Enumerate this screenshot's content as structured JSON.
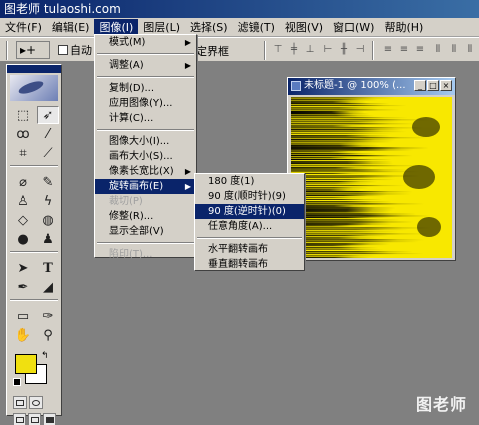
{
  "watermark_top": "图老师 tulaoshi.com",
  "watermark_bottom": "图老师",
  "menubar": {
    "items": [
      {
        "label": "文件(F)"
      },
      {
        "label": "编辑(E)"
      },
      {
        "label": "图像(I)"
      },
      {
        "label": "图层(L)"
      },
      {
        "label": "选择(S)"
      },
      {
        "label": "滤镜(T)"
      },
      {
        "label": "视图(V)"
      },
      {
        "label": "窗口(W)"
      },
      {
        "label": "帮助(H)"
      }
    ],
    "active_index": 2
  },
  "options": {
    "tool_preset": "▸+",
    "auto_select_label": "自动",
    "bounding_box_label": "定界框"
  },
  "image_menu": {
    "items": [
      {
        "label": "模式(M)",
        "submenu": true
      },
      {
        "sep": true
      },
      {
        "label": "调整(A)",
        "submenu": true
      },
      {
        "sep": true
      },
      {
        "label": "复制(D)..."
      },
      {
        "label": "应用图像(Y)..."
      },
      {
        "label": "计算(C)..."
      },
      {
        "sep": true
      },
      {
        "label": "图像大小(I)..."
      },
      {
        "label": "画布大小(S)..."
      },
      {
        "label": "像素长宽比(X)",
        "submenu": true
      },
      {
        "label": "旋转画布(E)",
        "submenu": true,
        "highlight": true
      },
      {
        "label": "裁切(P)",
        "disabled": true
      },
      {
        "label": "修整(R)..."
      },
      {
        "label": "显示全部(V)"
      },
      {
        "sep": true
      },
      {
        "label": "陷印(T)...",
        "disabled": true
      }
    ]
  },
  "rotate_menu": {
    "items": [
      {
        "label": "180 度(1)"
      },
      {
        "label": "90 度(顺时针)(9)"
      },
      {
        "label": "90 度(逆时针)(0)",
        "highlight": true
      },
      {
        "label": "任意角度(A)..."
      },
      {
        "sep": true
      },
      {
        "label": "水平翻转画布"
      },
      {
        "label": "垂直翻转画布"
      }
    ]
  },
  "document": {
    "title": "未标题-1 @ 100% (..."
  },
  "colors": {
    "foreground": "#f0e010",
    "background": "#ffffff",
    "highlight": "#0a246a",
    "canvas_yellow": "#f8e800"
  },
  "tools": [
    "marquee-tool",
    "move-tool",
    "lasso-tool",
    "magic-wand-tool",
    "crop-tool",
    "slice-tool",
    "healing-brush-tool",
    "brush-tool",
    "clone-stamp-tool",
    "history-brush-tool",
    "eraser-tool",
    "paint-bucket-tool",
    "blur-tool",
    "dodge-tool",
    "path-selection-tool",
    "type-tool",
    "pen-tool",
    "shape-tool",
    "notes-tool",
    "eyedropper-tool",
    "hand-tool",
    "zoom-tool"
  ]
}
